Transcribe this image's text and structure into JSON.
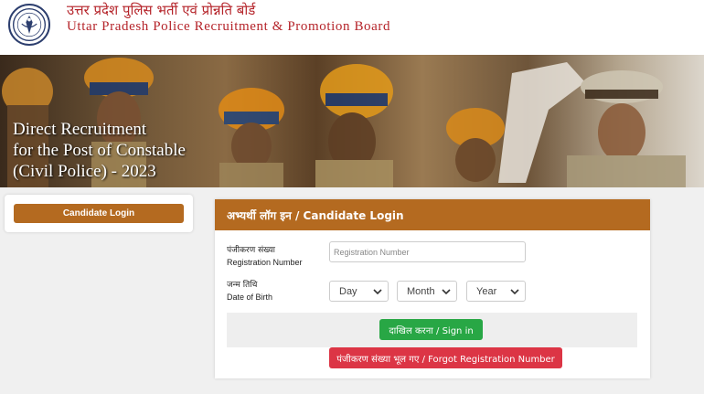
{
  "header": {
    "title_hindi": "उत्तर प्रदेश पुलिस भर्ती एवं प्रोन्नति बोर्ड",
    "title_english": "Uttar Pradesh Police Recruitment & Promotion Board",
    "logo_icon": "emblem-icon"
  },
  "banner": {
    "line1": "Direct Recruitment",
    "line2": "for the Post of Constable",
    "line3": "(Civil Police) - 2023"
  },
  "sidebar": {
    "candidate_login_label": "Candidate Login"
  },
  "login": {
    "header": "अभ्यर्थी लॉग इन / Candidate Login",
    "reg_label_hi": "पंजीकरण संख्या",
    "reg_label_en": "Registration Number",
    "reg_placeholder": "Registration Number",
    "dob_label_hi": "जन्म तिथि",
    "dob_label_en": "Date of Birth",
    "day_value": "Day",
    "month_value": "Month",
    "year_value": "Year",
    "sign_in_label": "दाखिल करना / Sign in",
    "forgot_label": "पंजीकरण संख्या भूल गए / Forgot Registration Number"
  },
  "colors": {
    "accent": "#b46a20",
    "title_red": "#b5242a",
    "sign_in_green": "#28a745",
    "forgot_red": "#dc3545"
  }
}
